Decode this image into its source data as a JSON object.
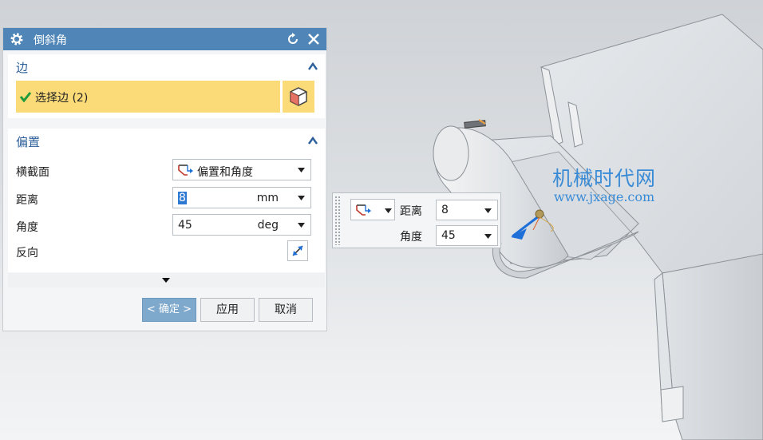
{
  "dialog": {
    "title": "倒斜角",
    "edge_section": {
      "title": "边",
      "select_label": "选择边 (2)"
    },
    "offset_section": {
      "title": "偏置",
      "cross_section_label": "横截面",
      "cross_section_value": "偏置和角度",
      "distance_label": "距离",
      "distance_value": "8",
      "distance_unit": "mm",
      "angle_label": "角度",
      "angle_value": "45",
      "angle_unit": "deg",
      "reverse_label": "反向"
    },
    "buttons": {
      "ok": "< 确定 >",
      "apply": "应用",
      "cancel": "取消"
    }
  },
  "onscreen_input": {
    "distance_label": "距离",
    "distance_value": "8",
    "angle_label": "角度",
    "angle_value": "45"
  },
  "watermark": {
    "title": "机械时代网",
    "url": "www.jxage.com"
  },
  "colors": {
    "title_bar": "#4f86b7",
    "section_title": "#2d5f9a",
    "selection_highlight": "#fbdb78",
    "watermark": "#3a8bd6"
  }
}
